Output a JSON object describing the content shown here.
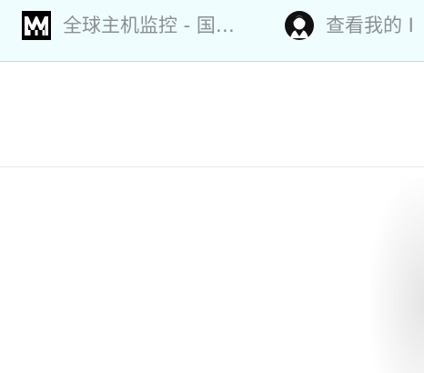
{
  "bookmarks_bar": {
    "items": [
      {
        "label": "全球主机监控 - 国…",
        "icon": "hostmonit-logo-icon"
      },
      {
        "label": "查看我的 I",
        "icon": "github-avatar-icon"
      }
    ]
  },
  "colors": {
    "bookmarks_bar_bg": "#f0fdff",
    "bookmark_text": "#8a8f92"
  }
}
